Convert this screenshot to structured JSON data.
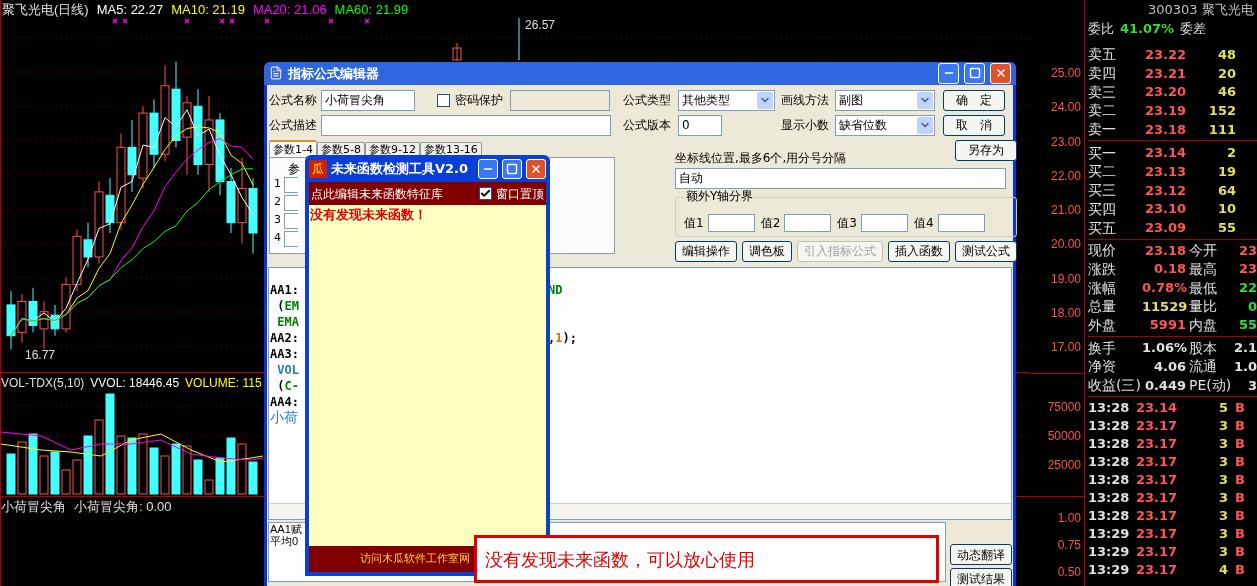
{
  "chart_header": {
    "title": "聚飞光电(日线)",
    "ma": [
      {
        "label": "MA5: 22.27",
        "color": "#ffffff"
      },
      {
        "label": "MA10: 21.19",
        "color": "#ffff00"
      },
      {
        "label": "MA20: 21.06",
        "color": "#ff00ff"
      },
      {
        "label": "MA60: 21.99",
        "color": "#00ff00"
      }
    ]
  },
  "price_marks": {
    "high": "26.57",
    "low": "16.77"
  },
  "volume_header": {
    "title": "VOL-TDX(5,10)",
    "items": [
      {
        "label": "VVOL: 18446.45",
        "color": "#ffffff"
      },
      {
        "label": "VOLUME: 115",
        "color": "#ffff00"
      }
    ]
  },
  "indicator_header": {
    "title": "小荷冒尖角",
    "value": "小荷冒尖角: 0.00"
  },
  "price_axis": [
    "25.00",
    "24.00",
    "23.00",
    "22.00",
    "21.00",
    "20.00",
    "19.00",
    "18.00",
    "17.00"
  ],
  "volume_axis": [
    "75000",
    "50000",
    "25000"
  ],
  "indicator_axis": [
    "1.00",
    "0.75",
    "0.50"
  ],
  "quote_panel": {
    "title": "300303 聚飞光电",
    "ratio": {
      "label": "委比",
      "value": "41.07%",
      "label2": "委差"
    },
    "asks": [
      {
        "label": "卖五",
        "price": "23.22",
        "volume": "48"
      },
      {
        "label": "卖四",
        "price": "23.21",
        "volume": "20"
      },
      {
        "label": "卖三",
        "price": "23.20",
        "volume": "46"
      },
      {
        "label": "卖二",
        "price": "23.19",
        "volume": "152"
      },
      {
        "label": "卖一",
        "price": "23.18",
        "volume": "111"
      }
    ],
    "bids": [
      {
        "label": "买一",
        "price": "23.14",
        "volume": "2"
      },
      {
        "label": "买二",
        "price": "23.13",
        "volume": "19"
      },
      {
        "label": "买三",
        "price": "23.12",
        "volume": "64"
      },
      {
        "label": "买四",
        "price": "23.10",
        "volume": "10"
      },
      {
        "label": "买五",
        "price": "23.09",
        "volume": "55"
      }
    ],
    "stats": [
      {
        "cells": [
          {
            "label": "现价",
            "value": "23.18",
            "color": "#ff5555"
          },
          {
            "label": "今开",
            "value": "23",
            "color": "#ff5555"
          }
        ]
      },
      {
        "cells": [
          {
            "label": "涨跌",
            "value": "0.18",
            "color": "#ff5555"
          },
          {
            "label": "最高",
            "value": "23",
            "color": "#ff5555"
          }
        ]
      },
      {
        "cells": [
          {
            "label": "涨幅",
            "value": "0.78%",
            "color": "#ff5555"
          },
          {
            "label": "最低",
            "value": "22",
            "color": "#33dd33"
          }
        ]
      },
      {
        "cells": [
          {
            "label": "总量",
            "value": "11529",
            "color": "#e0e060"
          },
          {
            "label": "量比",
            "value": "0",
            "color": "#33dd33"
          }
        ]
      },
      {
        "cells": [
          {
            "label": "外盘",
            "value": "5991",
            "color": "#ff5555"
          },
          {
            "label": "内盘",
            "value": "55",
            "color": "#33dd33"
          }
        ]
      }
    ],
    "fundamentals": [
      {
        "cells": [
          {
            "label": "换手",
            "value": "1.06%",
            "color": "#e0e0e0"
          },
          {
            "label": "股本",
            "value": "2.1",
            "color": "#e0e0e0"
          }
        ]
      },
      {
        "cells": [
          {
            "label": "净资",
            "value": "4.06",
            "color": "#e0e0e0"
          },
          {
            "label": "流通",
            "value": "1.0",
            "color": "#e0e0e0"
          }
        ]
      },
      {
        "cells": [
          {
            "label": "收益(三)",
            "value": "0.449",
            "color": "#e0e0e0"
          },
          {
            "label": "PE(动)",
            "value": "3",
            "color": "#e0e0e0"
          }
        ]
      }
    ],
    "ticks": [
      {
        "time": "13:28",
        "price": "23.14",
        "volume": "5",
        "side": "B"
      },
      {
        "time": "13:28",
        "price": "23.17",
        "volume": "3",
        "side": "B"
      },
      {
        "time": "13:28",
        "price": "23.17",
        "volume": "3",
        "side": "B"
      },
      {
        "time": "13:28",
        "price": "23.17",
        "volume": "3",
        "side": "B"
      },
      {
        "time": "13:28",
        "price": "23.17",
        "volume": "3",
        "side": "B"
      },
      {
        "time": "13:28",
        "price": "23.17",
        "volume": "3",
        "side": "B"
      },
      {
        "time": "13:28",
        "price": "23.17",
        "volume": "3",
        "side": "B"
      },
      {
        "time": "13:29",
        "price": "23.17",
        "volume": "3",
        "side": "B"
      },
      {
        "time": "13:29",
        "price": "23.17",
        "volume": "3",
        "side": "B"
      },
      {
        "time": "13:29",
        "price": "23.17",
        "volume": "4",
        "side": "B"
      }
    ]
  },
  "formula_editor": {
    "title": "指标公式编辑器",
    "name_label": "公式名称",
    "name_value": "小荷冒尖角",
    "password": {
      "label": "密码保护",
      "checked": false
    },
    "desc_label": "公式描述",
    "type_label": "公式类型",
    "type_value": "其他类型",
    "draw_label": "画线方法",
    "draw_value": "副图",
    "version_label": "公式版本",
    "version_value": "0",
    "decimals_label": "显示小数",
    "decimals_value": "缺省位数",
    "side_buttons": [
      "确　定",
      "取　消",
      "另存为"
    ],
    "tabs": [
      {
        "label": "参数1-4",
        "selected": true
      },
      {
        "label": "参数5-8",
        "selected": false
      },
      {
        "label": "参数9-12",
        "selected": false
      },
      {
        "label": "参数13-16",
        "selected": false
      }
    ],
    "param_header": "参",
    "param_rows": [
      "1",
      "2",
      "3",
      "4"
    ],
    "axis_label": "坐标线位置,最多6个,用分号分隔",
    "axis_value": "自动",
    "y_group": {
      "title": "额外Y轴分界",
      "fields": [
        "值1",
        "值2",
        "值3",
        "值4"
      ]
    },
    "buttons": [
      {
        "label": "编辑操作",
        "disabled": false
      },
      {
        "label": "调色板",
        "disabled": false
      },
      {
        "label": "引入指标公式",
        "disabled": true
      },
      {
        "label": "插入函数",
        "disabled": false
      },
      {
        "label": "测试公式",
        "disabled": false
      }
    ],
    "code_lines": [
      {
        "head": [
          {
            "text": "AA1:",
            "kind": "name"
          }
        ],
        "tail": [
          {
            "text": "ND",
            "kind": "function"
          }
        ]
      },
      {
        "head": [
          {
            "text": " (",
            "kind": "text"
          },
          {
            "text": "EM",
            "kind": "function"
          }
        ]
      },
      {
        "head": [
          {
            "text": " EMA",
            "kind": "function"
          }
        ]
      },
      {
        "head": [
          {
            "text": "AA2:",
            "kind": "name"
          }
        ],
        "tail": [
          {
            "text": ",",
            "kind": "text"
          },
          {
            "text": "1",
            "kind": "number"
          },
          {
            "text": ");",
            "kind": "text"
          }
        ]
      },
      {
        "head": [
          {
            "text": "AA3:",
            "kind": "name"
          }
        ]
      },
      {
        "head": [
          {
            "text": " VOL",
            "kind": "variable"
          }
        ]
      },
      {
        "head": [
          {
            "text": " (",
            "kind": "text"
          },
          {
            "text": "C-",
            "kind": "function"
          }
        ]
      },
      {
        "head": [
          {
            "text": "AA4:",
            "kind": "name"
          }
        ]
      },
      {
        "head": [
          {
            "text": "小荷",
            "kind": "label"
          }
        ]
      }
    ],
    "info_lines": [
      "AA1赋",
      "平均0"
    ],
    "bottom_buttons": [
      "动态翻译",
      "测试结果"
    ]
  },
  "detector": {
    "logo": "瓜",
    "title": "未来函数检测工具V2.0",
    "edit_link": "点此编辑未来函数特征库",
    "topmost": {
      "label": "窗口置顶",
      "checked": true
    },
    "result": "没有发现未来函数！",
    "footer": "访问木瓜软件工作室网"
  },
  "message": "没有发现未来函数，可以放心使用"
}
